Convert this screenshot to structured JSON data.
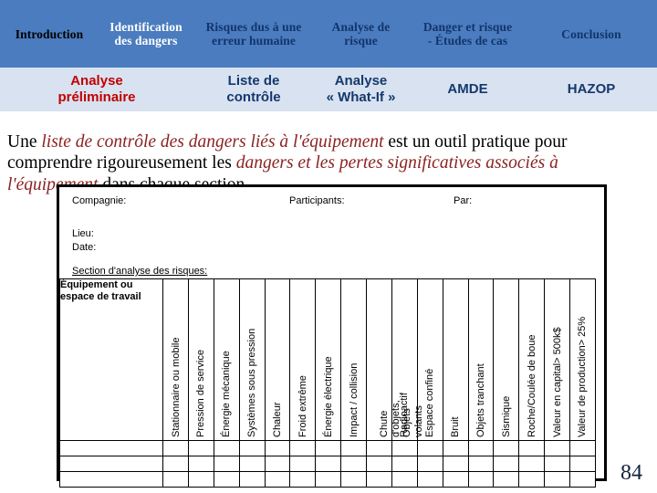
{
  "topnav": {
    "background_color": "#4a7cbf",
    "items": [
      {
        "label": "Introduction",
        "color": "#000000",
        "active": false
      },
      {
        "label": "Identification\ndes dangers",
        "color": "#ffffff",
        "active": true
      },
      {
        "label": "Risques dus à une\nerreur humaine",
        "color": "#13346b",
        "active": false
      },
      {
        "label": "Analyse de\nrisque",
        "color": "#13346b",
        "active": false
      },
      {
        "label": "Danger et risque\n- Études de cas",
        "color": "#13346b",
        "active": false
      },
      {
        "label": "Conclusion",
        "color": "#13346b",
        "active": false
      }
    ]
  },
  "subnav": {
    "background_color": "#d9e2f0",
    "items": [
      {
        "label": "Analyse\npréliminaire",
        "color": "#c00000",
        "active": true
      },
      {
        "label": "Liste de\ncontrôle",
        "color": "#14386e",
        "active": false
      },
      {
        "label": "Analyse\n« What-If »",
        "color": "#14386e",
        "active": false
      },
      {
        "label": "AMDE",
        "color": "#14386e",
        "active": false
      },
      {
        "label": "HAZOP",
        "color": "#14386e",
        "active": false
      }
    ]
  },
  "paragraph": {
    "accent_color": "#8c2222",
    "part1": "Une ",
    "em1": "liste de contrôle des dangers liés à l'équipement",
    "part2": " est un outil pratique pour comprendre rigoureusement les ",
    "em2": "dangers et les pertes significatives associés à l'équipement",
    "part3": " dans chaque section.."
  },
  "form": {
    "compagnie_label": "Compagnie:",
    "participants_label": "Participants:",
    "par_label": "Par:",
    "lieu_label": "Lieu:",
    "date_label": "Date:",
    "section_label": "Section d'analyse des risques:",
    "compagnie_value": "",
    "participants_value": "",
    "par_value": "",
    "lieu_value": "",
    "date_value": ""
  },
  "table": {
    "first_column_header": "Équipement\nou espace de\ntravail",
    "rotated_headers": [
      "Stationnaire ou mobile",
      "Pression de service",
      "Énergie mécanique",
      "Systèmes sous pression",
      "Chaleur",
      "Froid extrême",
      "Énergie électrique",
      "Impact / collision",
      "Chute d'objets,\nObjets volants",
      "Radioactif",
      "Espace confiné",
      "Bruit",
      "Objets tranchant",
      "Sismique",
      "Roche/Coulée de boue",
      "Valeur en capital> 500k$",
      "Valeur de production> 25%"
    ],
    "empty_row_count": 3
  },
  "page_number": "84"
}
